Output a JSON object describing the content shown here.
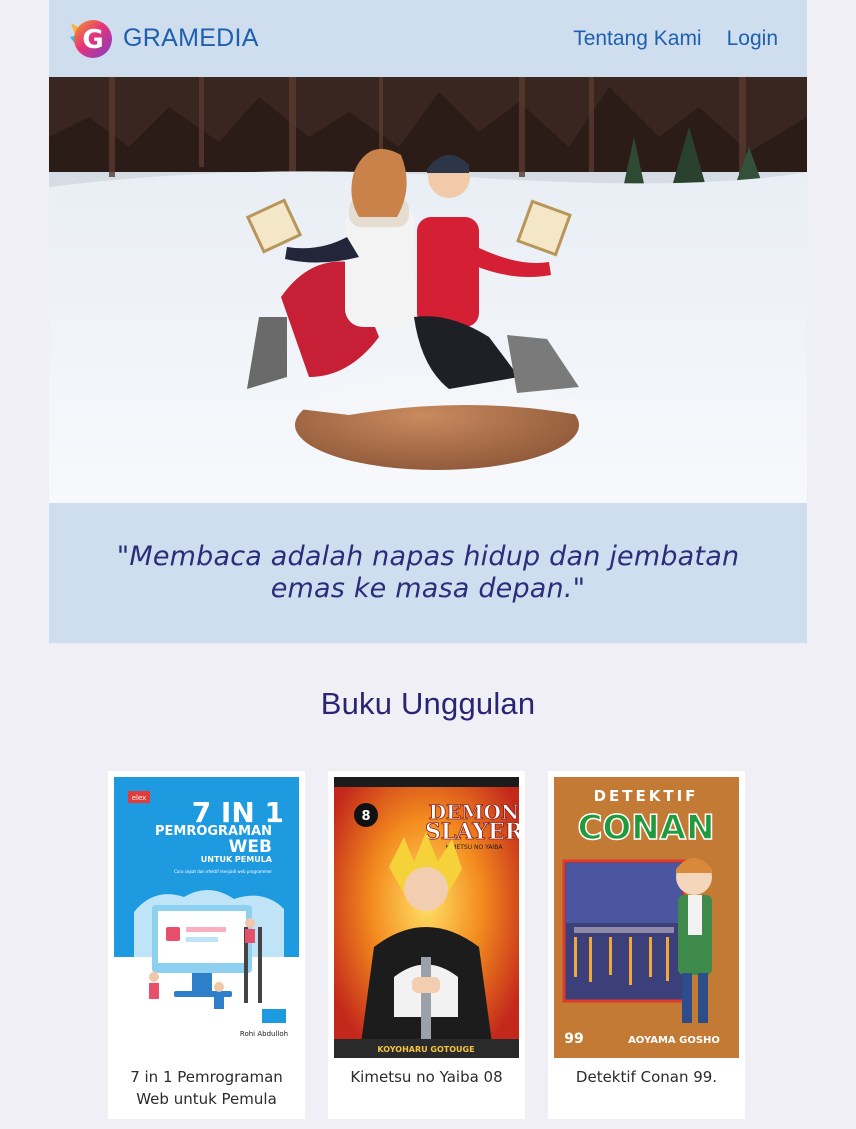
{
  "header": {
    "brand": "GRAMEDIA",
    "logo_letter": "G",
    "nav": [
      {
        "label": "Tentang Kami"
      },
      {
        "label": "Login"
      }
    ]
  },
  "hero": {
    "image": "two-women-reading-books-in-snow"
  },
  "quote": {
    "text": "\"Membaca adalah napas hidup dan jembatan emas ke masa depan.\""
  },
  "featured": {
    "title": "Buku Unggulan",
    "books": [
      {
        "title": "7 in 1 Pemrograman Web untuk Pemula",
        "cover": {
          "publisher": "elex",
          "line1": "7 IN 1",
          "line2": "PEMROGRAMAN",
          "line3": "WEB",
          "line4": "UNTUK PEMULA",
          "tagline": "Cara cepat dan efektif menjadi web programmer",
          "author": "Rohi Abdulloh"
        }
      },
      {
        "title": "Kimetsu no Yaiba 08",
        "cover": {
          "volume": "8",
          "line1": "DEMON",
          "line2": "SLAYER",
          "line3": "KIMETSU NO YAIBA",
          "author": "KOYOHARU GOTOUGE"
        }
      },
      {
        "title": "Detektif Conan 99.",
        "cover": {
          "line1": "DETEKTIF",
          "line2": "CONAN",
          "volume": "99",
          "author": "AOYAMA GOSHO"
        }
      }
    ]
  },
  "colors": {
    "accent": "#1e5fae",
    "header_bg": "#cfdeef",
    "page_bg": "#efeff5",
    "quote_text": "#2b2d7a",
    "section_title": "#2b2473"
  }
}
